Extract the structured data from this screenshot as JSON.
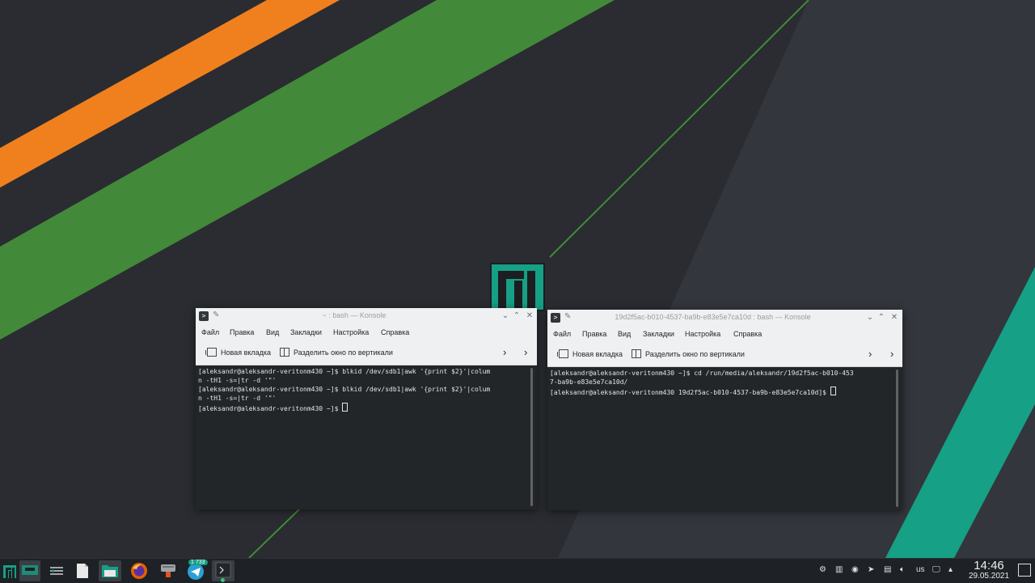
{
  "colors": {
    "orange": "#f0801e",
    "green": "#43893a",
    "teal": "#16a085",
    "background": "#2a2c31",
    "konsole_bg": "#232629"
  },
  "window_left": {
    "title": "~ : bash — Konsole",
    "menu": [
      "Файл",
      "Правка",
      "Вид",
      "Закладки",
      "Настройка",
      "Справка"
    ],
    "toolbar": {
      "new_tab": "Новая вкладка",
      "split": "Разделить окно по вертикали"
    },
    "lines": [
      "[aleksandr@aleksandr-veritonm430 ~]$ blkid /dev/sdb1|awk '{print $2}'|colum",
      "n -tH1 -s=|tr -d '\"'",
      "[aleksandr@aleksandr-veritonm430 ~]$ blkid /dev/sdb1|awk '{print $2}'|colum",
      "n -tH1 -s=|tr -d '\"'",
      "[aleksandr@aleksandr-veritonm430 ~]$ "
    ]
  },
  "window_right": {
    "title": "19d2f5ac-b010-4537-ba9b-e83e5e7ca10d : bash — Konsole",
    "menu": [
      "Файл",
      "Правка",
      "Вид",
      "Закладки",
      "Настройка",
      "Справка"
    ],
    "toolbar": {
      "new_tab": "Новая вкладка",
      "split": "Разделить окно по вертикали"
    },
    "lines": [
      "[aleksandr@aleksandr-veritonm430 ~]$ cd /run/media/aleksandr/19d2f5ac-b010-453",
      "7-ba9b-e83e5e7ca10d/",
      "[aleksandr@aleksandr-veritonm430 19d2f5ac-b010-4537-ba9b-e83e5e7ca10d]$ "
    ]
  },
  "taskbar": {
    "telegram_badge": "1 733",
    "keyboard_layout": "us",
    "time": "14:46",
    "date": "29.05.2021"
  }
}
